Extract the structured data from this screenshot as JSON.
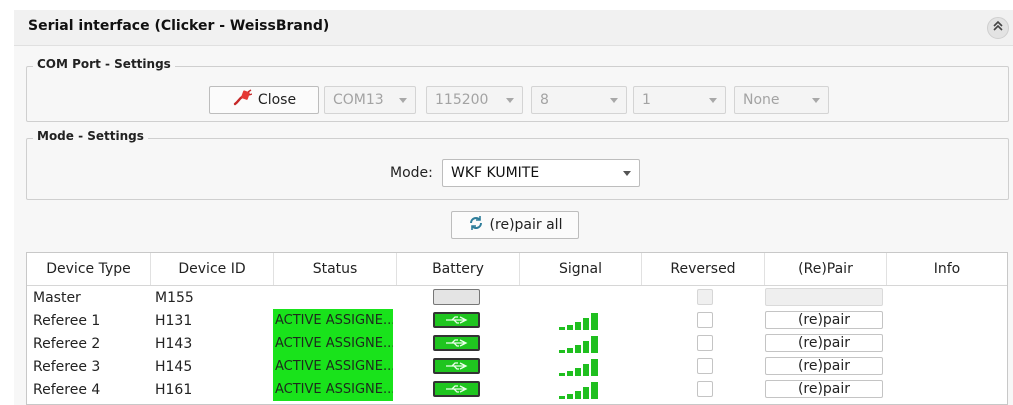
{
  "panel": {
    "title": "Serial interface (Clicker - WeissBrand)"
  },
  "com_settings": {
    "title": "COM Port - Settings",
    "close_label": "Close",
    "port": "COM13",
    "baud": "115200",
    "data_bits": "8",
    "stop_bits": "1",
    "parity": "None"
  },
  "mode_settings": {
    "title": "Mode - Settings",
    "mode_label": "Mode:",
    "mode_value": "WKF KUMITE"
  },
  "repair_all_label": "(re)pair all",
  "table": {
    "headers": [
      "Device Type",
      "Device ID",
      "Status",
      "Battery",
      "Signal",
      "Reversed",
      "(Re)Pair",
      "Info"
    ],
    "rows": [
      {
        "type": "Master",
        "id": "M155",
        "status": "",
        "battery": "empty",
        "signal": 0,
        "pair": ""
      },
      {
        "type": "Referee 1",
        "id": "H131",
        "status": "ACTIVE ASSIGNE...",
        "battery": "usb",
        "signal": 5,
        "pair": "(re)pair"
      },
      {
        "type": "Referee 2",
        "id": "H143",
        "status": "ACTIVE ASSIGNE...",
        "battery": "usb",
        "signal": 5,
        "pair": "(re)pair"
      },
      {
        "type": "Referee 3",
        "id": "H145",
        "status": "ACTIVE ASSIGNE...",
        "battery": "usb",
        "signal": 5,
        "pair": "(re)pair"
      },
      {
        "type": "Referee 4",
        "id": "H161",
        "status": "ACTIVE ASSIGNE...",
        "battery": "usb",
        "signal": 5,
        "pair": "(re)pair"
      }
    ]
  },
  "colors": {
    "status_active": "#19e31b",
    "battery_usb": "#1fc51f",
    "signal": "#1fbf1f"
  }
}
